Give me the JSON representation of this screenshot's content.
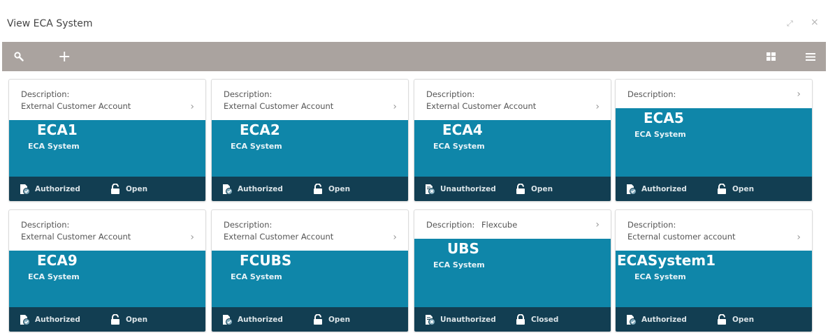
{
  "window": {
    "title": "View ECA System",
    "expand_glyph": "⤢",
    "close_glyph": "×"
  },
  "toolbar": {
    "search_icon": "search-icon",
    "add_glyph": "+",
    "grid_icon": "grid-view-icon",
    "list_icon": "list-view-icon"
  },
  "colors": {
    "toolbar": "#aaa39f",
    "tile_body": "#0f86a9",
    "tile_footer": "#123e52"
  },
  "tiles": [
    {
      "desc_label": "Description:",
      "desc_value": "External Customer Account",
      "name": "ECA1",
      "subtitle": "ECA System",
      "auth": "Authorized",
      "status": "Open"
    },
    {
      "desc_label": "Description:",
      "desc_value": "External Customer Account",
      "name": "ECA2",
      "subtitle": "ECA System",
      "auth": "Authorized",
      "status": "Open"
    },
    {
      "desc_label": "Description:",
      "desc_value": "External Customer Account",
      "name": "ECA4",
      "subtitle": "ECA System",
      "auth": "Unauthorized",
      "status": "Open"
    },
    {
      "desc_label": "Description:",
      "desc_value": "",
      "name": "ECA5",
      "subtitle": "ECA System",
      "auth": "Authorized",
      "status": "Open"
    },
    {
      "desc_label": "Description:",
      "desc_value": "External Customer Account",
      "name": "ECA9",
      "subtitle": "ECA System",
      "auth": "Authorized",
      "status": "Open"
    },
    {
      "desc_label": "Description:",
      "desc_value": "External Customer Account",
      "name": "FCUBS",
      "subtitle": "ECA System",
      "auth": "Authorized",
      "status": "Open"
    },
    {
      "desc_label": "Description:",
      "desc_value": "Flexcube",
      "name": "UBS",
      "subtitle": "ECA System",
      "auth": "Unauthorized",
      "status": "Closed"
    },
    {
      "desc_label": "Description:",
      "desc_value": "Ecternal customer account",
      "name": "ECASystem1",
      "subtitle": "ECA System",
      "auth": "Authorized",
      "status": "Open"
    }
  ],
  "chevron": "›"
}
